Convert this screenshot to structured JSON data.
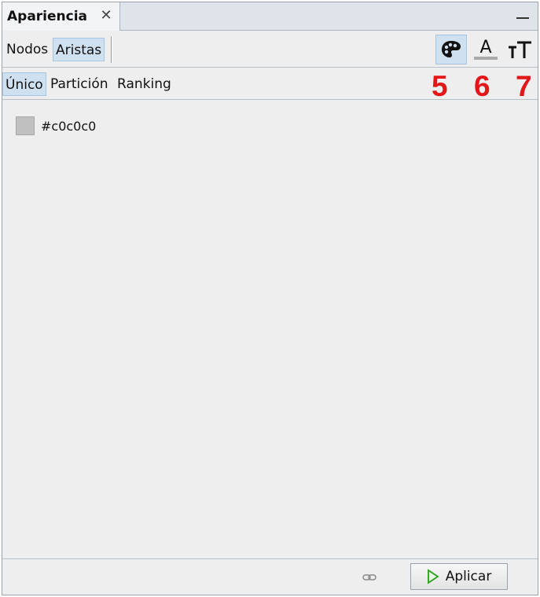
{
  "window": {
    "tab_title": "Apariencia",
    "close_glyph": "✕"
  },
  "toolbar": {
    "modes": [
      {
        "label": "Nodos",
        "selected": false
      },
      {
        "label": "Aristas",
        "selected": true
      }
    ],
    "icons": [
      {
        "name": "palette-icon",
        "selected": true,
        "annotation": "5"
      },
      {
        "name": "label-color-icon",
        "selected": false,
        "annotation": "6"
      },
      {
        "name": "text-size-icon",
        "selected": false,
        "annotation": "7"
      }
    ],
    "annotation_color": "#e3161a"
  },
  "subtabs": [
    {
      "label": "Único",
      "selected": true
    },
    {
      "label": "Partición",
      "selected": false
    },
    {
      "label": "Ranking",
      "selected": false
    }
  ],
  "content": {
    "color_value": "#c0c0c0",
    "swatch_color": "#c0c0c0"
  },
  "footer": {
    "apply_label": "Aplicar",
    "link_icon": "link-icon",
    "play_icon": "play-icon"
  }
}
